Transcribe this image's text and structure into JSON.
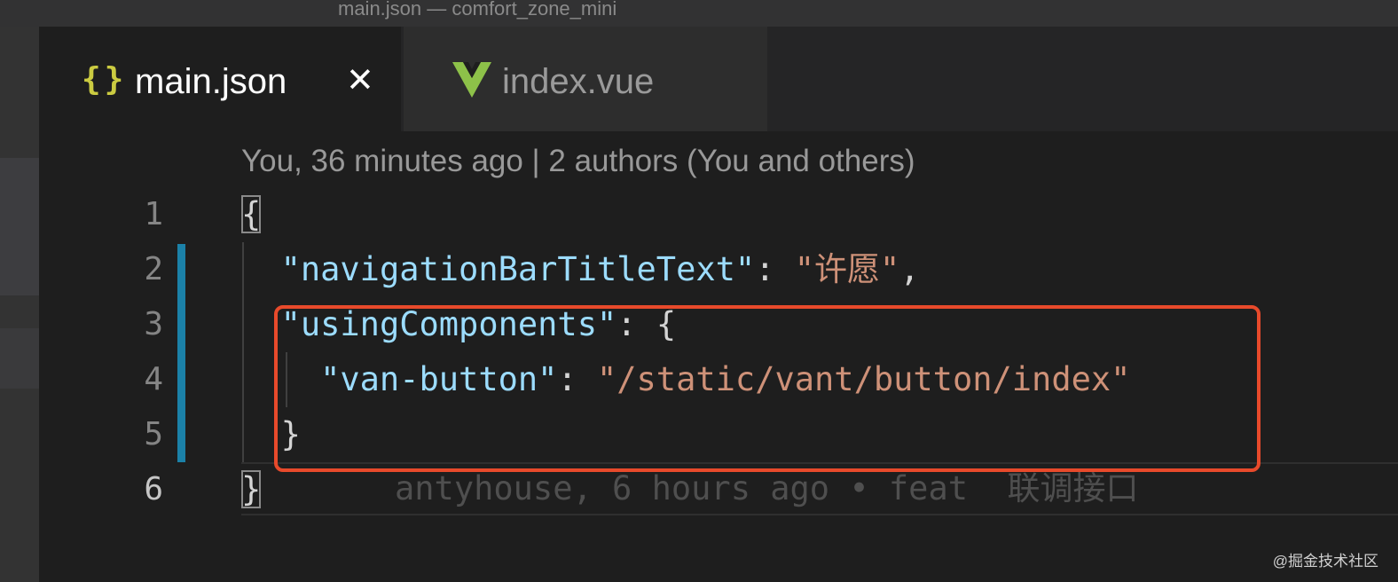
{
  "window": {
    "title": "main.json — comfort_zone_mini"
  },
  "tabs": [
    {
      "label": "main.json",
      "icon": "json-braces-icon",
      "active": true,
      "close_glyph": "✕"
    },
    {
      "label": "index.vue",
      "icon": "vue-logo-icon",
      "active": false
    }
  ],
  "editor": {
    "codelens": "You, 36 minutes ago | 2 authors (You and others)",
    "line_numbers": [
      "1",
      "2",
      "3",
      "4",
      "5",
      "6"
    ],
    "lines": {
      "l1": {
        "brace": "{"
      },
      "l2": {
        "key": "\"navigationBarTitleText\"",
        "colon": ": ",
        "value": "\"许愿\"",
        "comma": ","
      },
      "l3": {
        "key": "\"usingComponents\"",
        "colon": ": ",
        "brace": "{"
      },
      "l4": {
        "key": "\"van-button\"",
        "colon": ": ",
        "value": "\"/static/vant/button/index\""
      },
      "l5": {
        "brace": "}"
      },
      "l6": {
        "brace": "}"
      }
    },
    "blame": "antyhouse, 6 hours ago • feat  联调接口"
  },
  "watermark": "@掘金技术社区",
  "colors": {
    "highlight_box": "#e84a2b",
    "git_modified_bar": "#1b81a8",
    "json_key": "#9cdcfe",
    "json_string": "#ce9178"
  }
}
